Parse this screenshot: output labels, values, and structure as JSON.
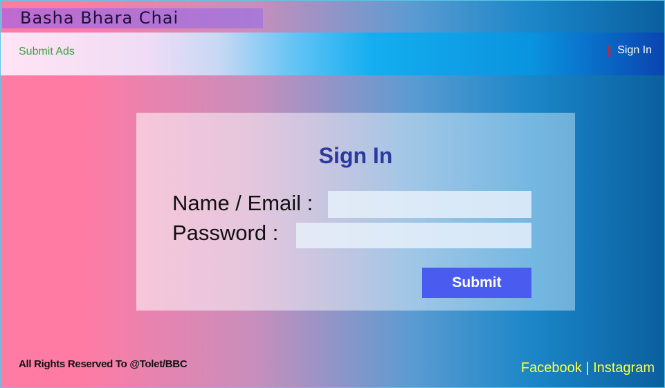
{
  "header": {
    "site_title": "Basha Bhara Chai"
  },
  "nav": {
    "submit_ads": "Submit Ads",
    "sign_in": "Sign In"
  },
  "form": {
    "title": "Sign In",
    "email_label": "Name / Email :",
    "password_label": "Password :",
    "email_value": "",
    "password_value": "",
    "submit_label": "Submit"
  },
  "footer": {
    "copyright": "All Rights Reserved To @Tolet/BBC",
    "facebook": "Facebook",
    "separator": "|",
    "instagram": "Instagram"
  },
  "colors": {
    "accent_button": "#4a5cf0",
    "title_text": "#2b3a9e",
    "nav_link": "#3aa247",
    "social_links": "#ffff3c",
    "signin_marker": "#d21f33"
  }
}
